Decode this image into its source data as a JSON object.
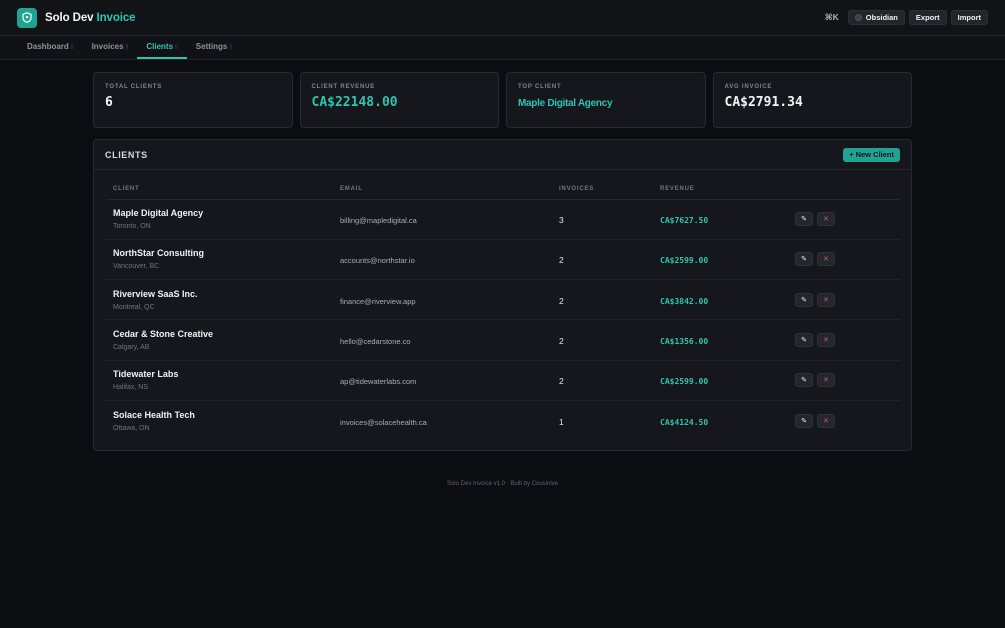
{
  "app": {
    "name": "Solo Dev",
    "name_accent": "Invoice",
    "shortcut": "⌘K",
    "theme_label": "Obsidian",
    "export_label": "Export",
    "import_label": "Import",
    "logo_icon": "shield-icon"
  },
  "nav": {
    "tabs": [
      {
        "label": "Dashboard",
        "glyph": "▯"
      },
      {
        "label": "Invoices",
        "glyph": "▯"
      },
      {
        "label": "Clients",
        "glyph": "▯",
        "active": true
      },
      {
        "label": "Settings",
        "glyph": "▯"
      }
    ]
  },
  "stats": {
    "total_clients": {
      "label": "Total Clients",
      "value": "6"
    },
    "client_revenue": {
      "label": "Client Revenue",
      "value": "CA$22148.00"
    },
    "top_client": {
      "label": "Top Client",
      "value": "Maple Digital Agency"
    },
    "avg_invoice": {
      "label": "Avg Invoice",
      "value": "CA$2791.34"
    }
  },
  "clients_panel": {
    "title": "Clients",
    "new_button": "+ New Client",
    "columns": [
      "Client",
      "Email",
      "Invoices",
      "Revenue",
      ""
    ],
    "rows": [
      {
        "name": "Maple Digital Agency",
        "location": "Toronto, ON",
        "email": "billing@mapledigital.ca",
        "invoices": "3",
        "revenue": "CA$7627.50"
      },
      {
        "name": "NorthStar Consulting",
        "location": "Vancouver, BC",
        "email": "accounts@northstar.io",
        "invoices": "2",
        "revenue": "CA$2599.00"
      },
      {
        "name": "Riverview SaaS Inc.",
        "location": "Montreal, QC",
        "email": "finance@riverview.app",
        "invoices": "2",
        "revenue": "CA$3842.00"
      },
      {
        "name": "Cedar & Stone Creative",
        "location": "Calgary, AB",
        "email": "hello@cedarstone.co",
        "invoices": "2",
        "revenue": "CA$1356.00"
      },
      {
        "name": "Tidewater Labs",
        "location": "Halifax, NS",
        "email": "ap@tidewaterlabs.com",
        "invoices": "2",
        "revenue": "CA$2599.00"
      },
      {
        "name": "Solace Health Tech",
        "location": "Ottawa, ON",
        "email": "invoices@solacehealth.ca",
        "invoices": "1",
        "revenue": "CA$4124.50"
      }
    ],
    "edit_icon": "✎",
    "delete_icon": "✕"
  },
  "footer": {
    "text": "Solo Dev Invoice v1.0 · Built by Cousinive"
  },
  "colors": {
    "accent": "#2ec4b0",
    "danger": "#e0524f",
    "background": "#0c0d10",
    "card": "#15171c"
  }
}
